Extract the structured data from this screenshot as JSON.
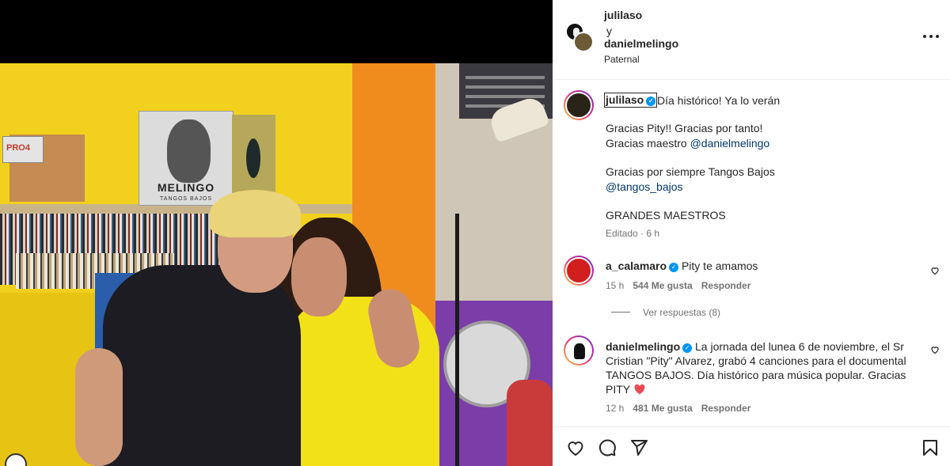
{
  "post": {
    "author": "julilaso",
    "connector": "y",
    "coauthor": "danielmelingo",
    "location": "Paternal"
  },
  "photo": {
    "album_title": "MELINGO",
    "album_subtitle": "TANGOS BAJOS",
    "box_label": "PRO4"
  },
  "caption": {
    "username": "julilaso",
    "verified": true,
    "first_line": "Día histórico! Ya lo verán",
    "line_2": "Gracias Pity!! Gracias por tanto!",
    "line_3_prefix": "Gracias maestro ",
    "line_3_mention": "@danielmelingo",
    "line_4": "Gracias por siempre Tangos Bajos",
    "line_5_mention": "@tangos_bajos",
    "line_6": "GRANDES MAESTROS",
    "meta": "Editado · 6 h"
  },
  "comments": [
    {
      "username": "a_calamaro",
      "verified": true,
      "text": "Pity te amamos",
      "time": "15 h",
      "likes": "544 Me gusta",
      "reply_label": "Responder",
      "view_replies": "Ver respuestas (8)"
    },
    {
      "username": "danielmelingo",
      "verified": true,
      "text": "La jornada del lunea 6 de noviembre, el Sr Cristian \"Pity\" Alvarez, grabó 4 canciones para el documental TANGOS BAJOS. Día histórico para música popular. Gracias PITY",
      "time": "12 h",
      "likes": "481 Me gusta",
      "reply_label": "Responder"
    }
  ],
  "colors": {
    "verified": "#0095f6",
    "link": "#00376b",
    "heart_red": "#ed4956",
    "secondary_text": "#737373"
  },
  "icons": [
    "more-icon",
    "verified-icon",
    "heart-icon",
    "comment-icon",
    "share-icon",
    "save-icon"
  ]
}
